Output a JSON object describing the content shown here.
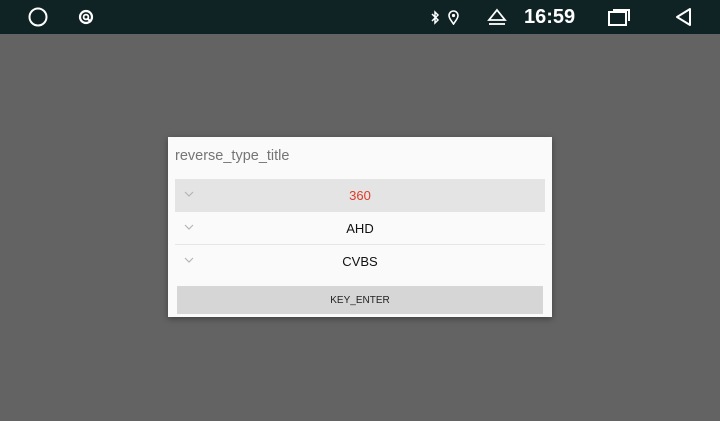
{
  "status_bar": {
    "time": "16:59",
    "icons": [
      "circle-home-icon",
      "app-refresh-icon",
      "bluetooth-icon",
      "location-pin-icon",
      "eject-icon",
      "recents-icon",
      "back-icon"
    ]
  },
  "dialog": {
    "title": "reverse_type_title",
    "options": [
      {
        "label": "360",
        "selected": true
      },
      {
        "label": "AHD",
        "selected": false
      },
      {
        "label": "CVBS",
        "selected": false
      }
    ],
    "enter_label": "KEY_ENTER"
  },
  "colors": {
    "status_bar_bg": "#0f2224",
    "scrim": "#636363",
    "dialog_bg": "#fafafa",
    "selected_row_bg": "#e4e4e4",
    "selected_text": "#e03a27",
    "button_bg": "#d6d6d6"
  }
}
